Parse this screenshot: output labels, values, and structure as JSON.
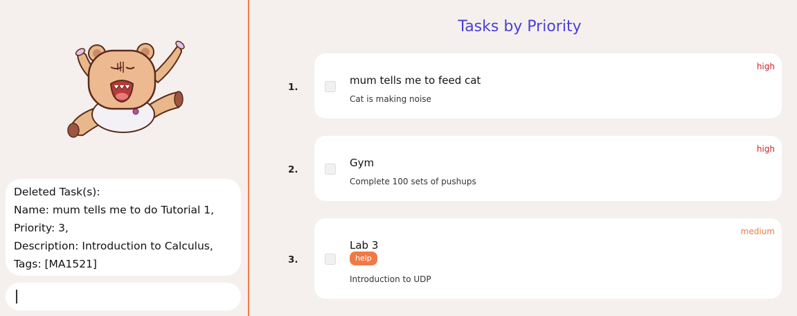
{
  "result_display": {
    "lines": [
      "Deleted Task(s):",
      "Name: mum tells me to do Tutorial 1,",
      "Priority: 3,",
      "Description: Introduction to Calculus,",
      "Tags: [MA1521]"
    ]
  },
  "command_box": {
    "value": ""
  },
  "task_panel": {
    "title": "Tasks by Priority",
    "tasks": [
      {
        "index": "1.",
        "name": "mum tells me to feed cat",
        "description": "Cat is making noise",
        "priority": "high",
        "tags": []
      },
      {
        "index": "2.",
        "name": "Gym",
        "description": "Complete 100 sets of pushups",
        "priority": "high",
        "tags": []
      },
      {
        "index": "3.",
        "name": "Lab 3",
        "description": "Introduction to UDP",
        "priority": "medium",
        "tags": [
          "help"
        ]
      }
    ]
  },
  "colors": {
    "accent": "#f07a45",
    "title": "#4a3fd4",
    "high_priority": "#d42020",
    "medium_priority": "#f07a45",
    "background": "#f5f0ee"
  },
  "icons": {
    "mascot": "screaming-bear-mascot"
  }
}
